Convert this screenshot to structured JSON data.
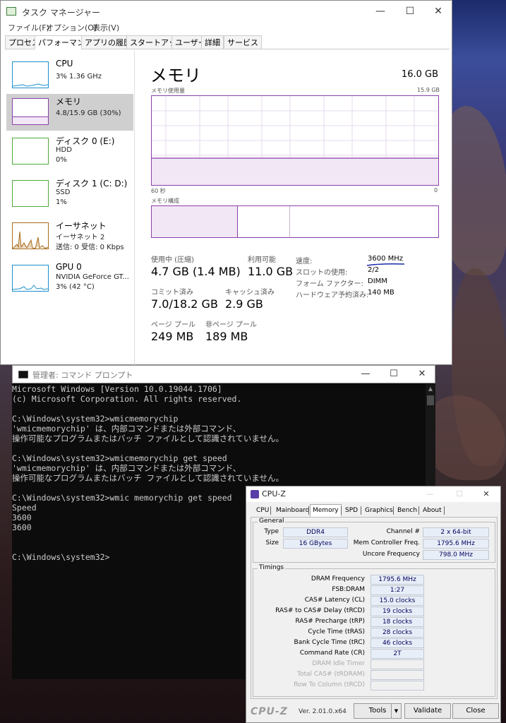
{
  "taskmgr": {
    "title": "タスク マネージャー",
    "menu": [
      "ファイル(F)",
      "オプション(O)",
      "表示(V)"
    ],
    "tabs": [
      "プロセス",
      "パフォーマンス",
      "アプリの履歴",
      "スタートアップ",
      "ユーザー",
      "詳細",
      "サービス"
    ],
    "sidebar": [
      {
        "name": "CPU",
        "line1": "3% 1.36 GHz",
        "line2": ""
      },
      {
        "name": "メモリ",
        "line1": "4.8/15.9 GB (30%)",
        "line2": ""
      },
      {
        "name": "ディスク 0 (E:)",
        "line1": "HDD",
        "line2": "0%"
      },
      {
        "name": "ディスク 1 (C: D:)",
        "line1": "SSD",
        "line2": "1%"
      },
      {
        "name": "イーサネット",
        "line1": "イーサネット 2",
        "line2": "送信: 0 受信: 0 Kbps"
      },
      {
        "name": "GPU 0",
        "line1": "NVIDIA GeForce GT...",
        "line2": "3% (42 °C)"
      }
    ],
    "main": {
      "title": "メモリ",
      "capacity": "16.0 GB",
      "usage_label": "メモリ使用量",
      "usage_max": "15.9 GB",
      "axis_left": "60 秒",
      "axis_right": "0",
      "composition_label": "メモリ構成",
      "usage_level_fraction": 0.3,
      "stats": {
        "in_use_label": "使用中 (圧縮)",
        "in_use_value": "4.7 GB (1.4 MB)",
        "available_label": "利用可能",
        "available_value": "11.0 GB",
        "committed_label": "コミット済み",
        "committed_value": "7.0/18.2 GB",
        "cached_label": "キャッシュ済み",
        "cached_value": "2.9 GB",
        "paged_label": "ページ プール",
        "paged_value": "249 MB",
        "nonpaged_label": "非ページ プール",
        "nonpaged_value": "189 MB"
      },
      "details": {
        "speed_label": "速度:",
        "speed_value": "3600 MHz",
        "slots_label": "スロットの使用:",
        "slots_value": "2/2",
        "form_label": "フォーム ファクター:",
        "form_value": "DIMM",
        "reserved_label": "ハードウェア予約済み:",
        "reserved_value": "140 MB"
      }
    }
  },
  "cmd": {
    "title": "管理者: コマンド プロンプト",
    "lines": [
      "Microsoft Windows [Version 10.0.19044.1706]",
      "(c) Microsoft Corporation. All rights reserved.",
      "",
      "C:\\Windows\\system32>wmicmemorychip",
      "'wmicmemorychip' は、内部コマンドまたは外部コマンド、",
      "操作可能なプログラムまたはバッチ ファイルとして認識されていません。",
      "",
      "C:\\Windows\\system32>wmicmemorychip get speed",
      "'wmicmemorychip' は、内部コマンドまたは外部コマンド、",
      "操作可能なプログラムまたはバッチ ファイルとして認識されていません。",
      "",
      "C:\\Windows\\system32>wmic memorychip get speed",
      "Speed",
      "3600",
      "3600",
      "",
      "",
      "C:\\Windows\\system32>"
    ]
  },
  "cpuz": {
    "title": "CPU-Z",
    "tabs": [
      "CPU",
      "Mainboard",
      "Memory",
      "SPD",
      "Graphics",
      "Bench",
      "About"
    ],
    "general": {
      "group_label": "General",
      "type_label": "Type",
      "type_value": "DDR4",
      "size_label": "Size",
      "size_value": "16 GBytes",
      "channel_label": "Channel #",
      "channel_value": "2 x 64-bit",
      "mcf_label": "Mem Controller Freq.",
      "mcf_value": "1795.6 MHz",
      "uncore_label": "Uncore Frequency",
      "uncore_value": "798.0 MHz"
    },
    "timings": {
      "group_label": "Timings",
      "rows": [
        {
          "label": "DRAM Frequency",
          "value": "1795.6 MHz",
          "dim": false
        },
        {
          "label": "FSB:DRAM",
          "value": "1:27",
          "dim": false
        },
        {
          "label": "CAS# Latency (CL)",
          "value": "15.0 clocks",
          "dim": false
        },
        {
          "label": "RAS# to CAS# Delay (tRCD)",
          "value": "19 clocks",
          "dim": false
        },
        {
          "label": "RAS# Precharge (tRP)",
          "value": "18 clocks",
          "dim": false
        },
        {
          "label": "Cycle Time (tRAS)",
          "value": "28 clocks",
          "dim": false
        },
        {
          "label": "Bank Cycle Time (tRC)",
          "value": "46 clocks",
          "dim": false
        },
        {
          "label": "Command Rate (CR)",
          "value": "2T",
          "dim": false
        },
        {
          "label": "DRAM Idle Timer",
          "value": "",
          "dim": true
        },
        {
          "label": "Total CAS# (tRDRAM)",
          "value": "",
          "dim": true
        },
        {
          "label": "Row To Column (tRCD)",
          "value": "",
          "dim": true
        }
      ]
    },
    "logo": "CPU-Z",
    "version": "Ver. 2.01.0.x64",
    "buttons": {
      "tools": "Tools",
      "validate": "Validate",
      "close": "Close"
    }
  },
  "colors": {
    "memory_accent": "#8b3fa8",
    "cpu_accent": "#1a8fc9",
    "disk_accent": "#4daa3a",
    "eth_accent": "#a86a1a"
  }
}
